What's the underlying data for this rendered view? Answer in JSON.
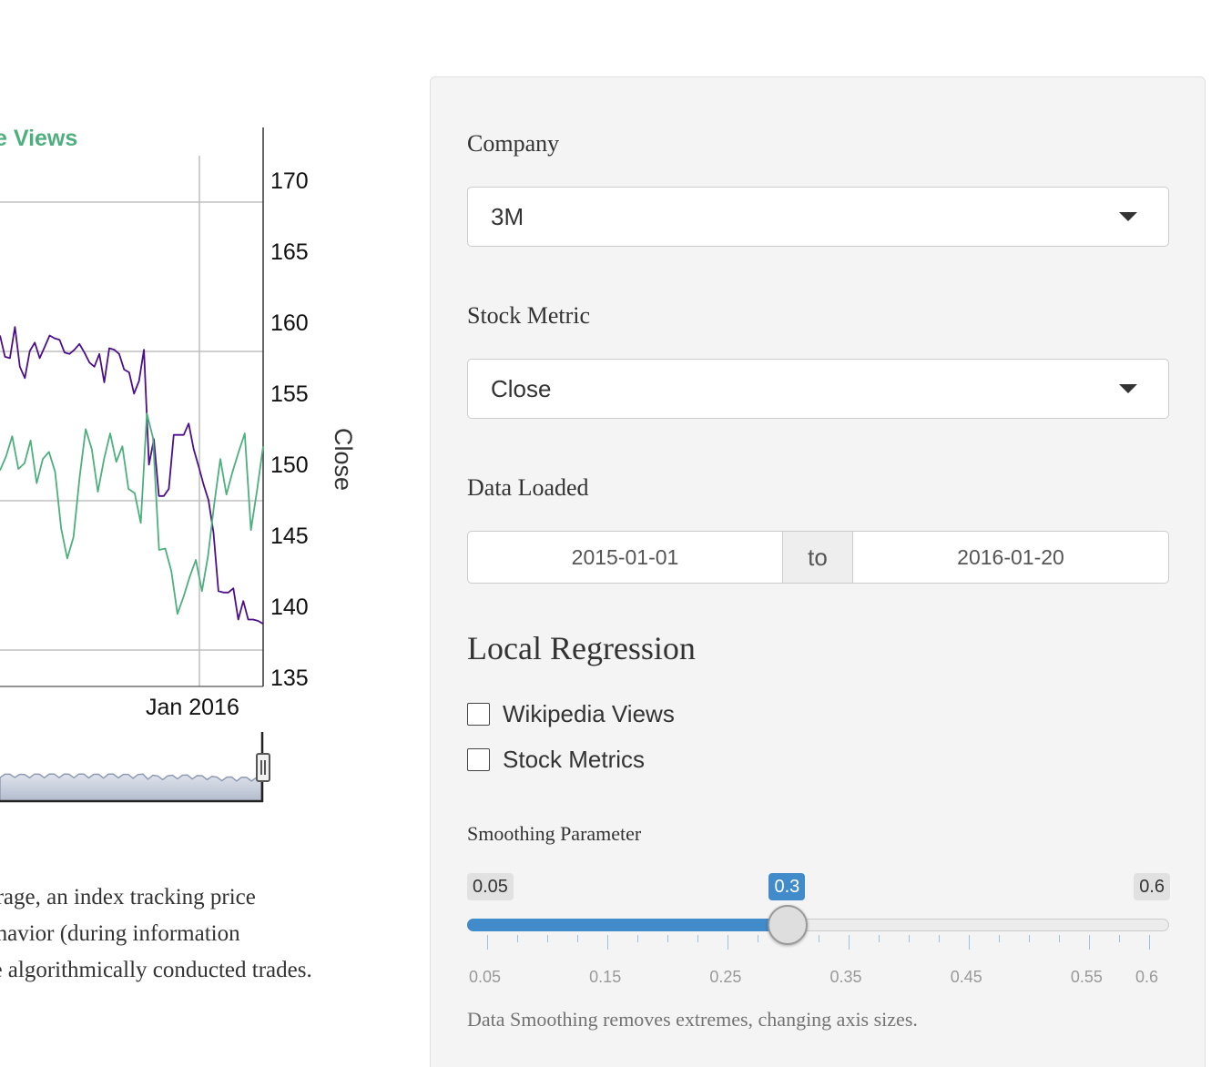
{
  "chart": {
    "legend_label": "e Views",
    "y_ticks": [
      "170",
      "165",
      "160",
      "155",
      "150",
      "145",
      "140",
      "135"
    ],
    "x_tick": "Jan 2016",
    "y_label": "Close",
    "colors": {
      "close": "#4b0f8a",
      "views": "#4daf7e",
      "navigator": "#8f9bb3"
    }
  },
  "chart_data": {
    "type": "line",
    "title": "",
    "xlabel": "",
    "ylabel": "Close",
    "ylim": [
      135,
      170
    ],
    "series": [
      {
        "name": "Close",
        "values": [
          159.2,
          157.7,
          157.6,
          159.8,
          157.0,
          156.2,
          158.1,
          158.7,
          157.6,
          158.4,
          159.2,
          159.0,
          158.9,
          158.0,
          157.9,
          158.2,
          158.6,
          158.0,
          157.3,
          157.0,
          157.9,
          155.9,
          158.3,
          158.2,
          157.9,
          156.8,
          156.6,
          155.1,
          156.0,
          158.2,
          150.1,
          151.9,
          147.9,
          147.9,
          148.4,
          152.2,
          152.2,
          152.2,
          153.0,
          151.2,
          150.0,
          148.7,
          147.6,
          145.3,
          141.2,
          141.1,
          141.1,
          141.4,
          139.2,
          140.5,
          139.2,
          139.2,
          139.1,
          138.9
        ]
      },
      {
        "name": "Wikipedia Views",
        "values": [
          149.7,
          150.7,
          152.1,
          149.8,
          150.2,
          151.8,
          148.8,
          150.5,
          151.0,
          149.6,
          145.6,
          143.5,
          145.0,
          149.2,
          152.6,
          151.2,
          148.2,
          150.5,
          152.3,
          150.3,
          151.4,
          148.4,
          148.1,
          146.0,
          153.7,
          152.0,
          144.1,
          144.2,
          142.6,
          139.6,
          140.8,
          142.2,
          143.4,
          141.2,
          143.7,
          147.3,
          150.5,
          148.0,
          149.6,
          151.0,
          152.3,
          145.5,
          148.3,
          151.4
        ]
      }
    ]
  },
  "caption": {
    "line1": "verage, an index tracking price",
    "line2": "behavior (during information",
    "line3": "ble algorithmically conducted trades."
  },
  "panel": {
    "company_label": "Company",
    "company_value": "3M",
    "metric_label": "Stock Metric",
    "metric_value": "Close",
    "data_loaded_label": "Data Loaded",
    "date_from": "2015-01-01",
    "date_sep": "to",
    "date_to": "2016-01-20",
    "local_regression_heading": "Local Regression",
    "checkbox_views": "Wikipedia Views",
    "checkbox_metrics": "Stock Metrics",
    "smoothing_label": "Smoothing Parameter",
    "slider": {
      "min_label": "0.05",
      "max_label": "0.6",
      "value_label": "0.3",
      "min": 0.05,
      "max": 0.6,
      "value": 0.3,
      "tick_labels": [
        "0.05",
        "0.15",
        "0.25",
        "0.35",
        "0.45",
        "0.55",
        "0.6"
      ]
    },
    "help_text": "Data Smoothing removes extremes, changing axis sizes."
  }
}
